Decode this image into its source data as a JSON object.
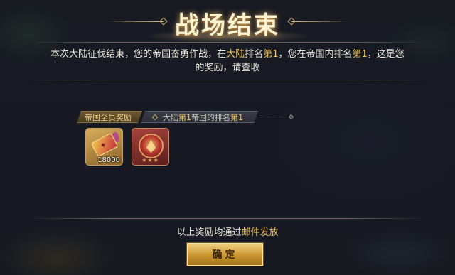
{
  "dialog": {
    "title": "战场结束",
    "message": {
      "part1": "本次大陆征伐结束，您的帝国奋勇作战，在",
      "rank_scope": "大陆",
      "part2": "排名",
      "rank1": "第1",
      "part3": "，您在帝国内排名",
      "rank2": "第1",
      "part4": "，这是您的奖励，请查收"
    },
    "tabs": [
      {
        "label": "帝国全员奖励",
        "active": true
      },
      {
        "label_parts": {
          "a": "大陆",
          "b": "第1",
          "c": "帝国的排名",
          "d": "第1"
        },
        "active": false
      }
    ],
    "rewards": [
      {
        "icon": "ticket-icon",
        "count": "18000"
      },
      {
        "icon": "emblem-icon",
        "stars": "★★★"
      }
    ],
    "footer": {
      "prefix": "以上奖励均通过",
      "highlight": "邮件发放"
    },
    "confirm_label": "确定"
  },
  "colors": {
    "highlight": "#f0c65a",
    "button_gold": "#c9952f",
    "title_glow": "#fff4d2"
  }
}
